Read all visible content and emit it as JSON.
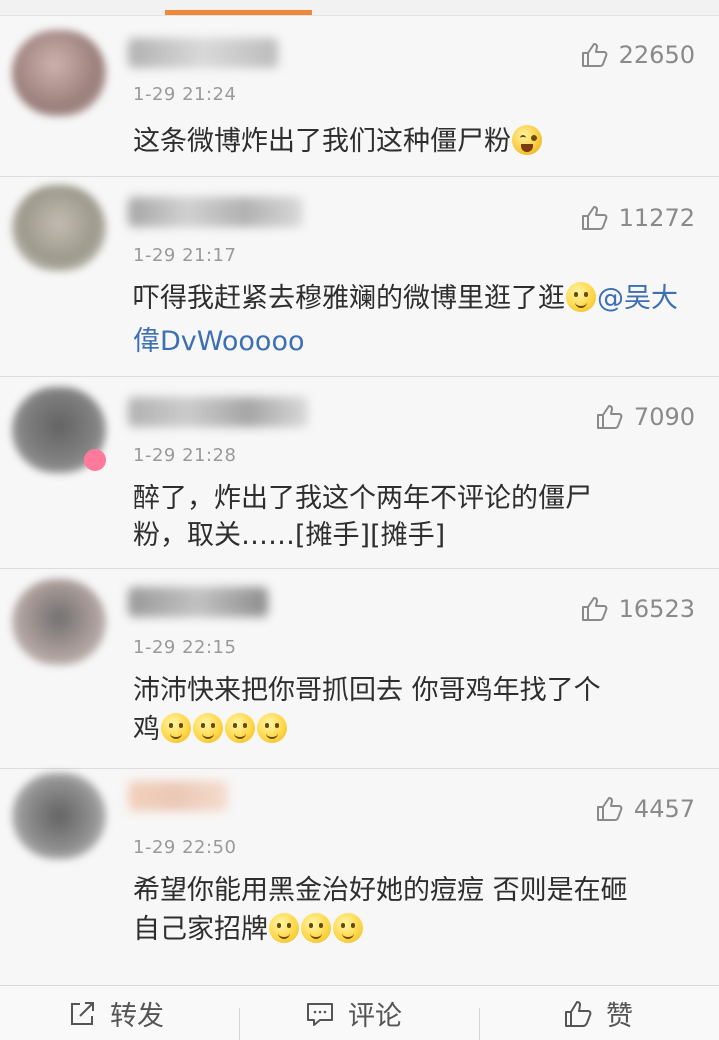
{
  "comments": [
    {
      "time": "1-29 21:24",
      "likes": "22650",
      "text": "这条微博炸出了我们这种僵尸粉",
      "emoji_after": [
        "laugh-cry"
      ]
    },
    {
      "time": "1-29 21:17",
      "likes": "11272",
      "text": "吓得我赶紧去穆雅斓的微博里逛了逛",
      "mention": "@吴大偉DvWooooo",
      "emoji_after": [
        "smirk"
      ]
    },
    {
      "time": "1-29 21:28",
      "likes": "7090",
      "text_line1": "醉了，炸出了我这个两年不评论的僵尸",
      "text_line2": "粉，取关……[摊手][摊手]"
    },
    {
      "time": "1-29 22:15",
      "likes": "16523",
      "text_line1": "沛沛快来把你哥抓回去 你哥鸡年找了个",
      "text_line2": "鸡",
      "emoji_after": [
        "smirk",
        "smirk",
        "smirk",
        "smirk"
      ]
    },
    {
      "time": "1-29 22:50",
      "likes": "4457",
      "text_line1": "希望你能用黑金治好她的痘痘 否则是在砸",
      "text_line2": "自己家招牌",
      "emoji_after": [
        "smirk",
        "smirk",
        "smirk"
      ]
    }
  ],
  "bottom_bar": {
    "repost": "转发",
    "comment": "评论",
    "like": "赞"
  },
  "colors": {
    "accent": "#f0883a",
    "mention": "#3d6fb4"
  }
}
